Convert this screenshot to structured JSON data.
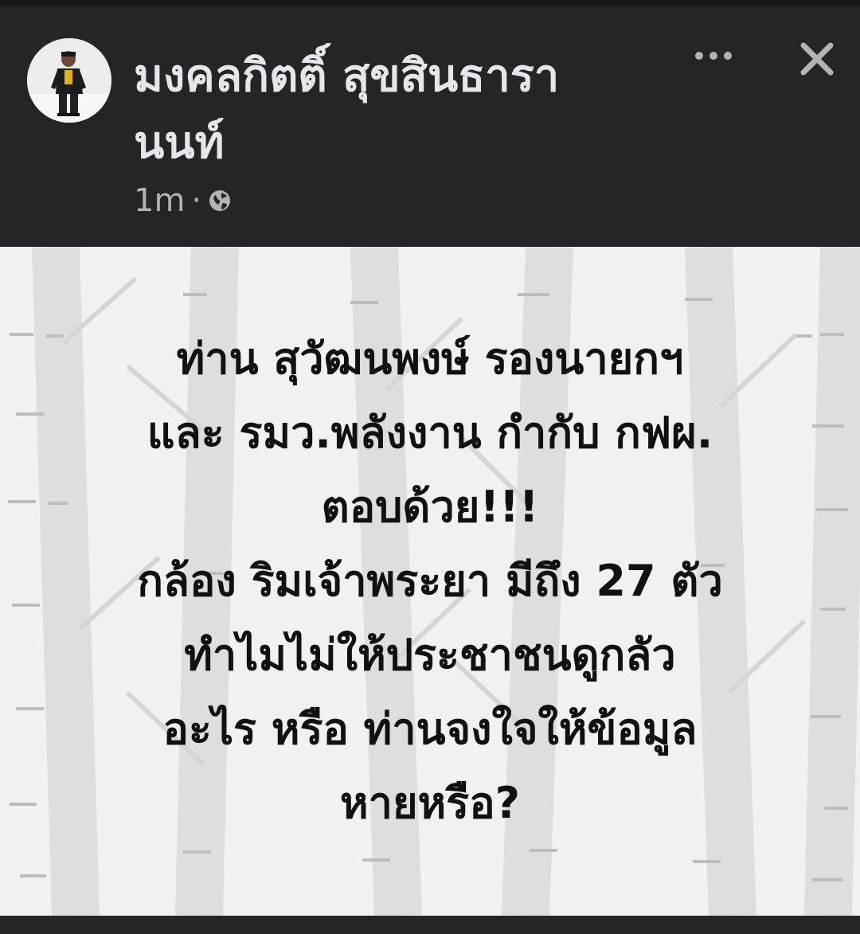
{
  "post": {
    "author": {
      "name_line1": "มงคลกิตติ์ สุขสินธารา",
      "name_line2": "นนท์",
      "avatar_icon": "person-avatar"
    },
    "timestamp": "1m",
    "separator": "·",
    "privacy_icon": "globe-icon",
    "more_icon": "more-horizontal-icon",
    "close_icon": "close-icon",
    "background_style": "birch-forest-pattern",
    "text_lines": [
      "ท่าน สุวัฒนพงษ์ รองนายกฯ",
      "และ รมว.พลังงาน กำกับ กฟผ.",
      "ตอบด้วย!!!",
      "กล้อง ริมเจ้าพระยา มีถึง 27 ตัว",
      "ทำไมไม่ให้ประชาชนดูกลัว",
      "อะไร หรือ ท่านจงใจให้ข้อมูล",
      "หายหรือ?"
    ]
  },
  "colors": {
    "header_bg": "#242526",
    "name_text": "#e4e6eb",
    "meta_text": "#b0b3b8",
    "post_bg": "#f1f1f1",
    "post_text": "#111111"
  }
}
